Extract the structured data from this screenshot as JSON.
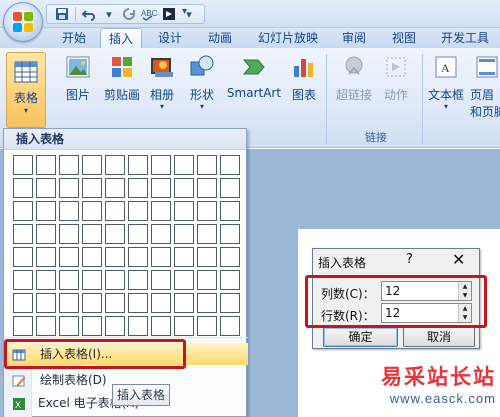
{
  "qat": {
    "more": "▾"
  },
  "tabs": [
    {
      "label": "开始"
    },
    {
      "label": "插入"
    },
    {
      "label": "设计"
    },
    {
      "label": "动画"
    },
    {
      "label": "幻灯片放映"
    },
    {
      "label": "审阅"
    },
    {
      "label": "视图"
    },
    {
      "label": "开发工具"
    }
  ],
  "ribbon": {
    "table": "表格",
    "picture": "图片",
    "clipart": "剪贴画",
    "album": "相册",
    "shapes": "形状",
    "smartart": "SmartArt",
    "chart": "图表",
    "hyperlink": "超链接",
    "action": "动作",
    "links_group": "链接",
    "textbox": "文本框",
    "header_line1": "页眉",
    "header_line2": "和页脚"
  },
  "menu": {
    "header": "插入表格",
    "items": [
      {
        "label": "插入表格(I)..."
      },
      {
        "label": "绘制表格(D)"
      },
      {
        "label": "Excel 电子表格(X)"
      }
    ],
    "grid_cols": 10,
    "grid_rows": 8
  },
  "tooltip": "插入表格",
  "dialog": {
    "title": "插入表格",
    "help": "?",
    "close": "✕",
    "columns_label": "列数(C)：",
    "columns_value": "12",
    "rows_label": "行数(R)：",
    "rows_value": "12",
    "ok": "确定",
    "cancel": "取消"
  },
  "watermark": {
    "cn": "易采站长站",
    "en": "www.easck.com"
  },
  "colors": {
    "highlight_border": "#c4171c",
    "menu_highlight": "#ffd96b",
    "ribbon_text": "#15428b"
  }
}
